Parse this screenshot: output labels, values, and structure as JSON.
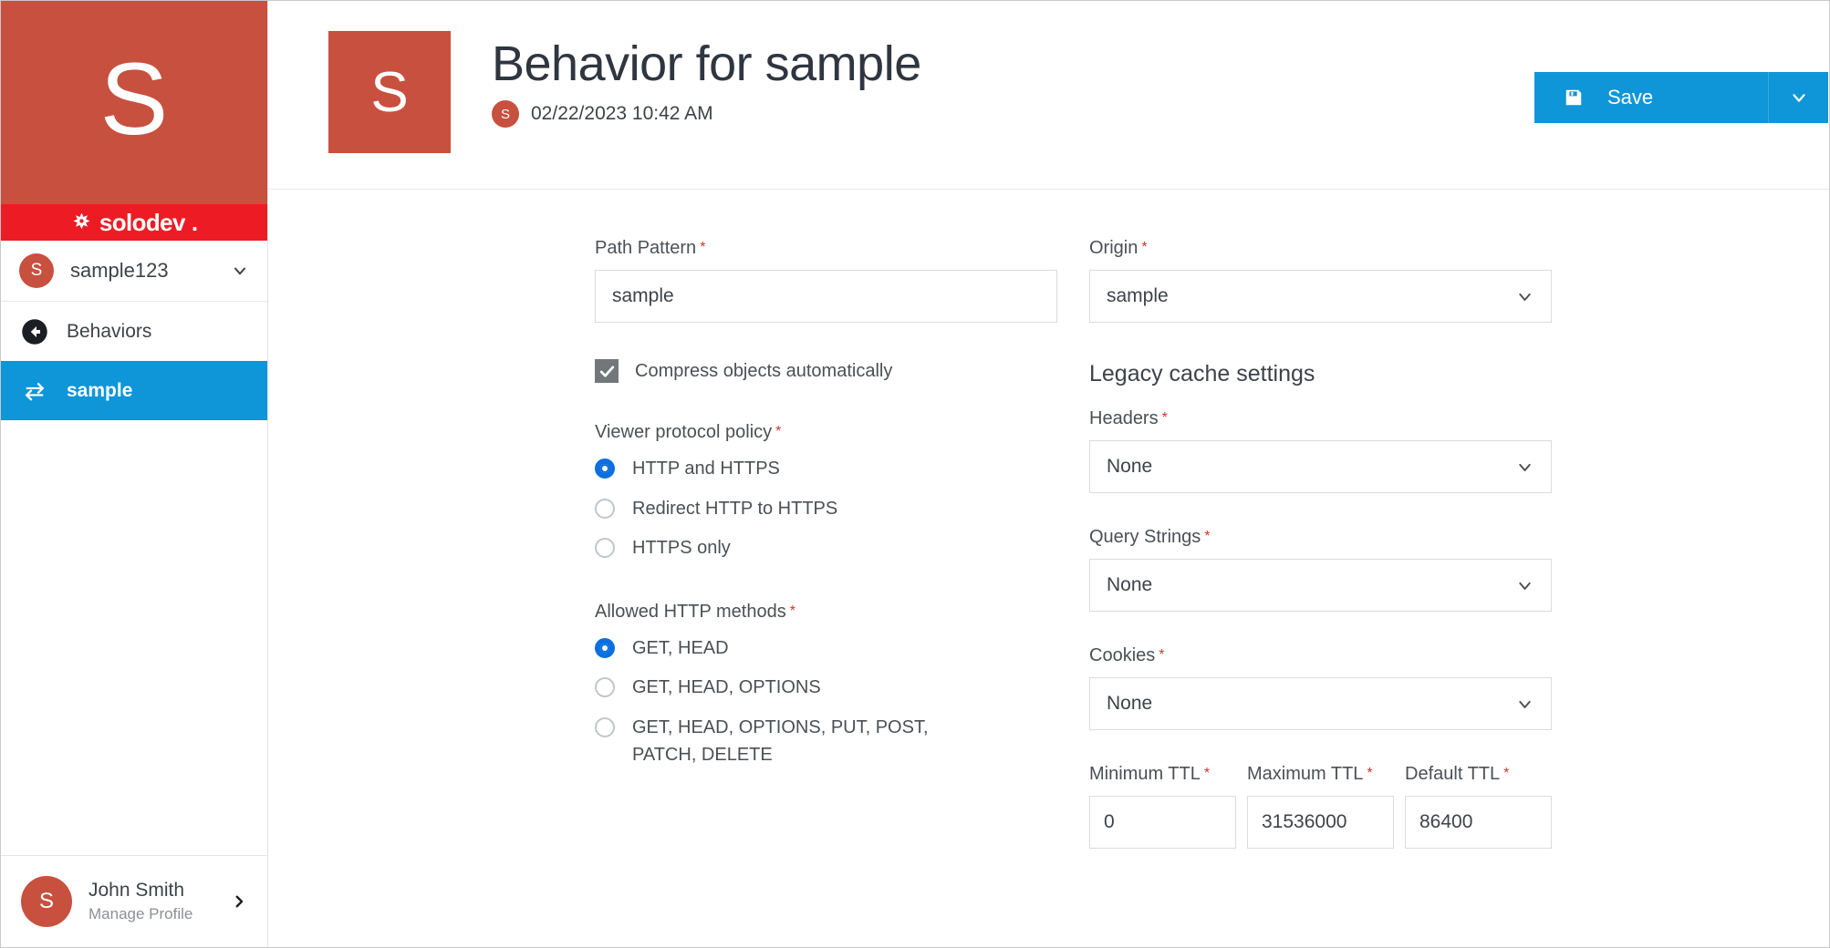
{
  "sidebar": {
    "brand_letter": "S",
    "brand_word": "solodev",
    "brand_dot": ".",
    "account": {
      "avatar_letter": "S",
      "name": "sample123",
      "chevron_icon": "chevron-down-icon"
    },
    "nav_items": [
      {
        "label": "Behaviors",
        "icon": "arrow-circle-left-icon",
        "active": false
      },
      {
        "label": "sample",
        "icon": "exchange-arrows-icon",
        "active": true
      }
    ],
    "profile": {
      "avatar_letter": "S",
      "name": "John Smith",
      "subtitle": "Manage Profile",
      "chevron_icon": "chevron-right-icon"
    }
  },
  "header": {
    "thumb_letter": "S",
    "title": "Behavior for sample",
    "meta_avatar_letter": "S",
    "meta_date": "02/22/2023 10:42 AM",
    "save": {
      "label": "Save",
      "icon": "floppy-save-icon",
      "dropdown_icon": "chevron-down-icon"
    }
  },
  "form": {
    "left": {
      "path_pattern": {
        "label": "Path Pattern",
        "required": "*",
        "value": "sample",
        "placeholder": "Path Pattern"
      },
      "compress": {
        "label": "Compress objects automatically",
        "checked": true
      },
      "viewer_protocol": {
        "label": "Viewer protocol policy",
        "required": "*",
        "options": [
          {
            "label": "HTTP and HTTPS",
            "selected": true
          },
          {
            "label": "Redirect HTTP to HTTPS",
            "selected": false
          },
          {
            "label": "HTTPS only",
            "selected": false
          }
        ]
      },
      "allowed_methods": {
        "label": "Allowed HTTP methods",
        "required": "*",
        "options": [
          {
            "label": "GET, HEAD",
            "selected": true
          },
          {
            "label": "GET, HEAD, OPTIONS",
            "selected": false
          },
          {
            "label": "GET, HEAD, OPTIONS, PUT, POST, PATCH, DELETE",
            "selected": false
          }
        ]
      }
    },
    "right": {
      "origin": {
        "label": "Origin",
        "required": "*",
        "value": "sample"
      },
      "legacy_heading": "Legacy cache settings",
      "headers": {
        "label": "Headers",
        "required": "*",
        "value": "None"
      },
      "query_strings": {
        "label": "Query Strings",
        "required": "*",
        "value": "None"
      },
      "cookies": {
        "label": "Cookies",
        "required": "*",
        "value": "None"
      },
      "ttl": [
        {
          "label": "Minimum TTL",
          "required": "*",
          "value": "0"
        },
        {
          "label": "Maximum TTL",
          "required": "*",
          "value": "31536000"
        },
        {
          "label": "Default TTL",
          "required": "*",
          "value": "86400"
        }
      ]
    }
  },
  "colors": {
    "brand_red": "#c8503f",
    "logo_red": "#ed1c24",
    "accent_blue": "#0e96d8",
    "radio_blue": "#0b6fe0",
    "required_red": "#d0342c",
    "text_dark": "#3d4349"
  }
}
